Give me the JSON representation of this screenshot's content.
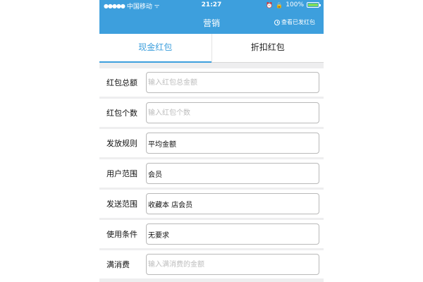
{
  "status_bar": {
    "carrier": "中国移动",
    "signal": "●●●●●",
    "wifi": "ᯤ",
    "time": "21:27",
    "alarm": "⏰",
    "lock": "🔒",
    "battery": "100%"
  },
  "nav": {
    "title": "营销",
    "history_link": "查看已发红包"
  },
  "tabs": [
    {
      "label": "现金红包",
      "active": true
    },
    {
      "label": "折扣红包",
      "active": false
    }
  ],
  "form": {
    "rows": [
      {
        "label": "红包总额",
        "value": "",
        "placeholder": "输入红包总金额"
      },
      {
        "label": "红包个数",
        "value": "",
        "placeholder": "输入红包个数"
      },
      {
        "label": "发放规则",
        "value": "平均金额",
        "placeholder": ""
      },
      {
        "label": "用户范围",
        "value": "会员",
        "placeholder": ""
      },
      {
        "label": "发送范围",
        "value": "收藏本 店会员",
        "placeholder": ""
      },
      {
        "label": "使用条件",
        "value": "无要求",
        "placeholder": ""
      },
      {
        "label": "满消费",
        "value": "",
        "placeholder": "输入满消费的金额"
      }
    ]
  },
  "colors": {
    "brand": "#3d9fdd",
    "background": "#eeeeef",
    "battery": "#7ddc5c"
  }
}
